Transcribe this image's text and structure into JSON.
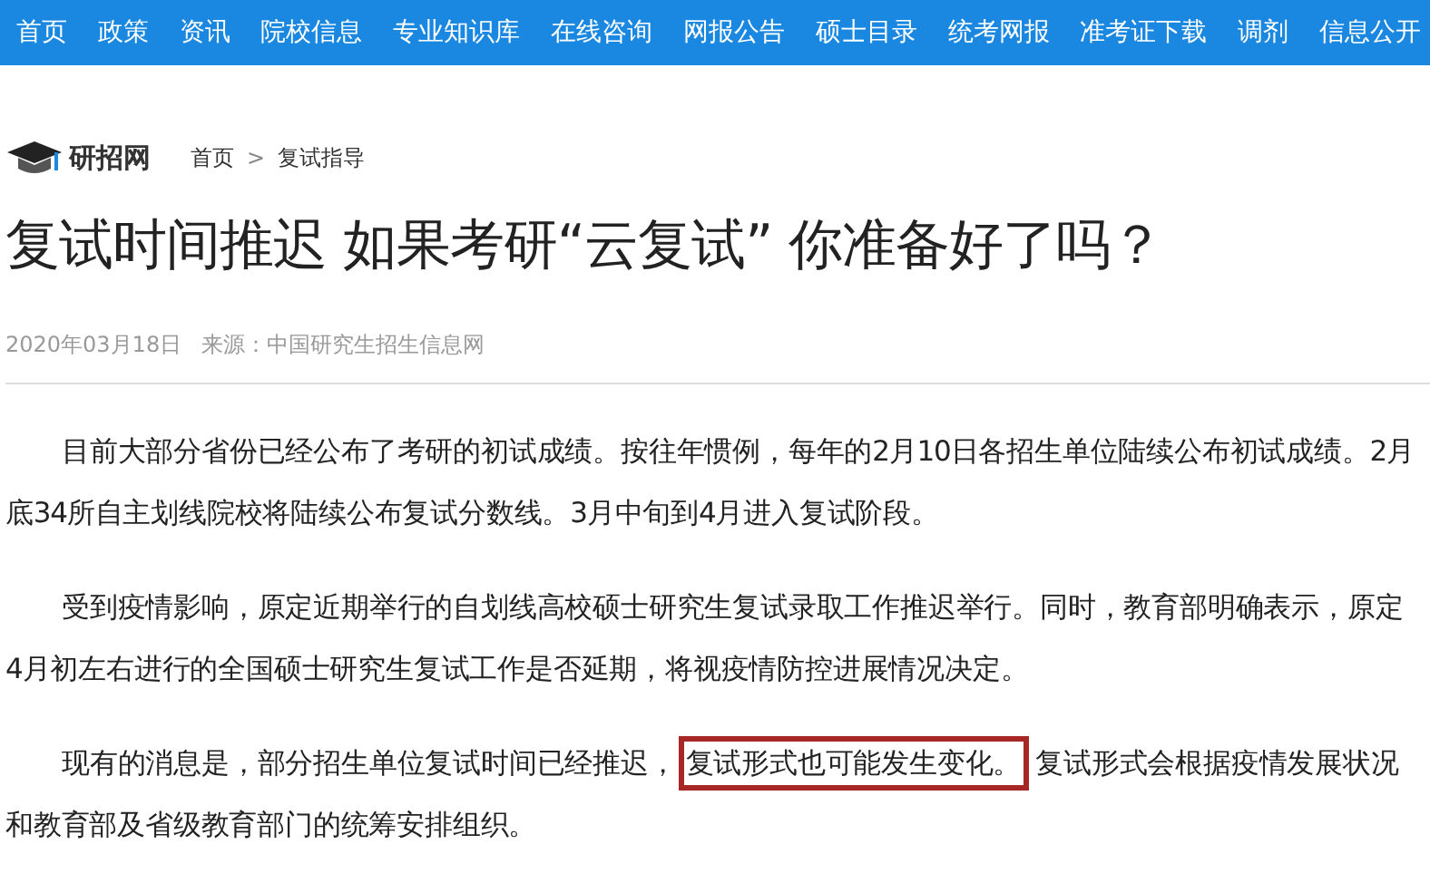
{
  "nav": [
    {
      "label": "首页"
    },
    {
      "label": "政策"
    },
    {
      "label": "资讯"
    },
    {
      "label": "院校信息"
    },
    {
      "label": "专业知识库"
    },
    {
      "label": "在线咨询"
    },
    {
      "label": "网报公告"
    },
    {
      "label": "硕士目录"
    },
    {
      "label": "统考网报"
    },
    {
      "label": "准考证下载"
    },
    {
      "label": "调剂"
    },
    {
      "label": "信息公开"
    }
  ],
  "logo": {
    "name": "研招网"
  },
  "breadcrumb": [
    {
      "label": "首页"
    },
    {
      "label": "复试指导"
    }
  ],
  "breadcrumb_separator": ">",
  "article": {
    "title": "复试时间推迟 如果考研“云复试” 你准备好了吗？",
    "date": "2020年03月18日",
    "source": "来源：中国研究生招生信息网",
    "paragraphs": [
      [
        {
          "text": "目前大部分省份已经公布了考研的初试成绩。按往年惯例，每年的2月10日各招生单位陆续公布初试成绩。2月底34所自主划线院校将陆续公布复试分数线。3月中旬到4月进入复试阶段。",
          "highlighted": false
        }
      ],
      [
        {
          "text": "受到疫情影响，原定近期举行的自划线高校硕士研究生复试录取工作推迟举行。同时，教育部明确表示，原定4月初左右进行的全国硕士研究生复试工作是否延期，将视疫情防控进展情况决定。",
          "highlighted": false
        }
      ],
      [
        {
          "text": "现有的消息是，部分招生单位复试时间已经推迟，",
          "highlighted": false
        },
        {
          "text": "复试形式也可能发生变化。",
          "highlighted": true
        },
        {
          "text": "复试形式会根据疫情发展状况和教育部及省级教育部门的统筹安排组织。",
          "highlighted": false
        }
      ]
    ]
  }
}
